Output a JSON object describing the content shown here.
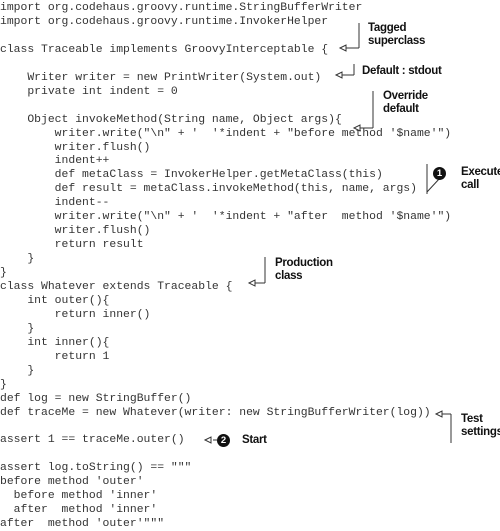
{
  "code_lines": [
    "import org.codehaus.groovy.runtime.StringBufferWriter",
    "import org.codehaus.groovy.runtime.InvokerHelper",
    "",
    "class Traceable implements GroovyInterceptable {",
    "",
    "    Writer writer = new PrintWriter(System.out)",
    "    private int indent = 0",
    "",
    "    Object invokeMethod(String name, Object args){",
    "        writer.write(\"\\n\" + '  '*indent + \"before method '$name'\")",
    "        writer.flush()",
    "        indent++",
    "        def metaClass = InvokerHelper.getMetaClass(this)",
    "        def result = metaClass.invokeMethod(this, name, args)",
    "        indent--",
    "        writer.write(\"\\n\" + '  '*indent + \"after  method '$name'\")",
    "        writer.flush()",
    "        return result",
    "    }",
    "}",
    "class Whatever extends Traceable {",
    "    int outer(){",
    "        return inner()",
    "    }",
    "    int inner(){",
    "        return 1",
    "    }",
    "}",
    "def log = new StringBuffer()",
    "def traceMe = new Whatever(writer: new StringBufferWriter(log))",
    "",
    "assert 1 == traceMe.outer()",
    "",
    "assert log.toString() == \"\"\"",
    "before method 'outer'",
    "  before method 'inner'",
    "  after  method 'inner'",
    "after  method 'outer'\"\"\""
  ],
  "annotations": {
    "tagged_superclass": "Tagged\nsuperclass",
    "default_stdout": "Default : stdout",
    "override_default": "Override\ndefault",
    "execute_call": "Execute\ncall",
    "production_class": "Production\nclass",
    "test_settings": "Test\nsettings",
    "start": "Start"
  },
  "callouts": {
    "one": "1",
    "two": "2"
  }
}
